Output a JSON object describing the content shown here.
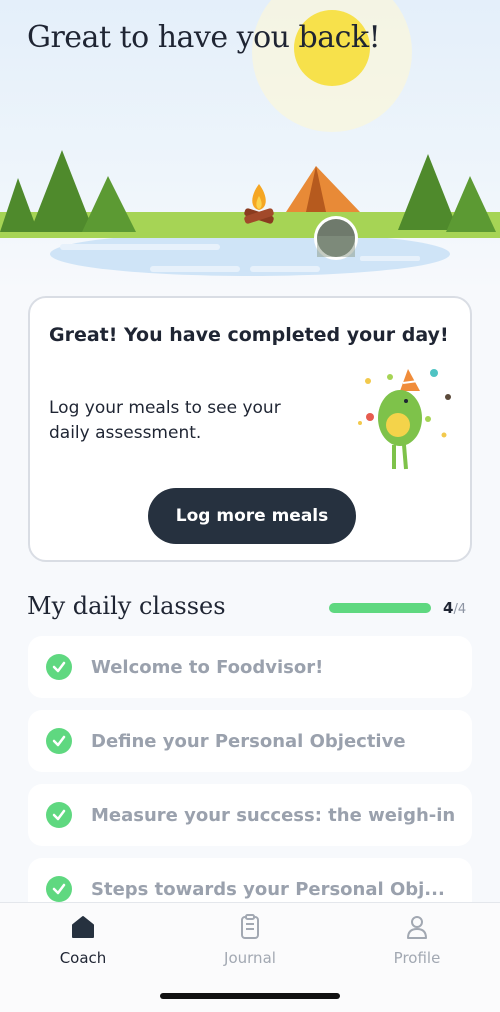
{
  "hero": {
    "greeting": "Great to have you back!"
  },
  "summary_card": {
    "title": "Great! You have completed your day!",
    "message": "Log your meals to see your daily assessment.",
    "button_label": "Log more meals",
    "mascot_icon": "avocado-party-mascot-icon"
  },
  "classes": {
    "title": "My daily classes",
    "progress": {
      "completed": 4,
      "total": 4,
      "completed_text": "4",
      "total_text": "/4",
      "fraction": 1.0
    },
    "items": [
      {
        "label": "Welcome to Foodvisor!",
        "icon": "check-circle-icon"
      },
      {
        "label": "Define your Personal Objective",
        "icon": "check-circle-icon"
      },
      {
        "label": "Measure your success: the weigh-in",
        "icon": "check-circle-icon"
      },
      {
        "label": "Steps towards your Personal Obj...",
        "icon": "check-circle-icon"
      }
    ]
  },
  "tabbar": {
    "tabs": [
      {
        "label": "Coach",
        "icon": "home-icon",
        "active": true
      },
      {
        "label": "Journal",
        "icon": "journal-icon",
        "active": false
      },
      {
        "label": "Profile",
        "icon": "profile-icon",
        "active": false
      }
    ]
  },
  "colors": {
    "accent_green": "#5fd880",
    "button_dark": "#26313f",
    "muted_text": "#9aa1ad"
  }
}
